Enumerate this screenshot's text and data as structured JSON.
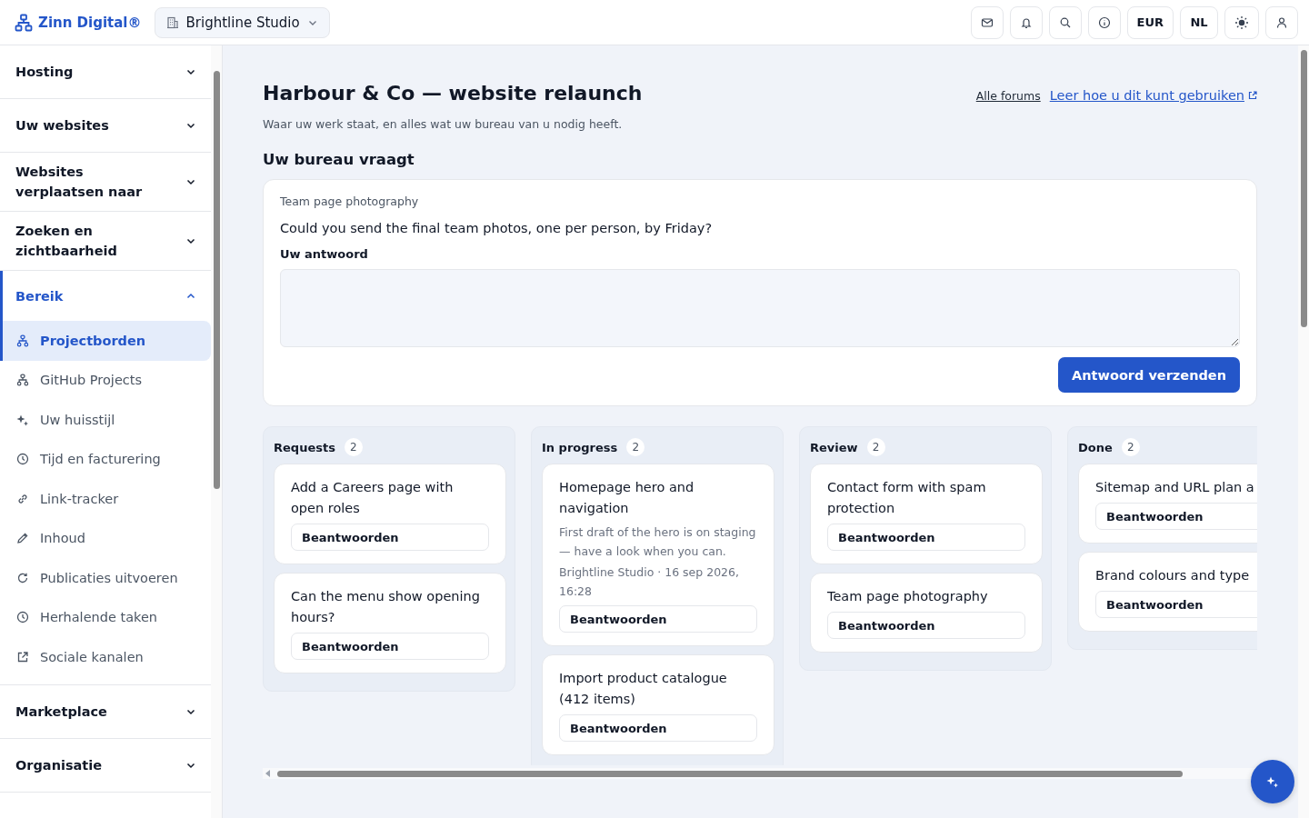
{
  "brand": {
    "name": "Zinn Digital®"
  },
  "workspace": {
    "label": "Brightline Studio"
  },
  "toolbar": {
    "currency": "EUR",
    "language": "NL"
  },
  "sidebar": {
    "groups": [
      {
        "label": "Hosting",
        "expanded": false
      },
      {
        "label": "Uw websites",
        "expanded": false
      },
      {
        "label": "Websites verplaatsen naar",
        "expanded": false
      },
      {
        "label": "Zoeken en zichtbaarheid",
        "expanded": false
      },
      {
        "label": "Bereik",
        "expanded": true,
        "children": [
          {
            "label": "Projectborden",
            "selected": true
          },
          {
            "label": "GitHub Projects",
            "selected": false
          },
          {
            "label": "Uw huisstijl",
            "selected": false
          },
          {
            "label": "Tijd en facturering",
            "selected": false
          },
          {
            "label": "Link-tracker",
            "selected": false
          },
          {
            "label": "Inhoud",
            "selected": false
          },
          {
            "label": "Publicaties uitvoeren",
            "selected": false
          },
          {
            "label": "Herhalende taken",
            "selected": false
          },
          {
            "label": "Sociale kanalen",
            "selected": false
          }
        ]
      },
      {
        "label": "Marketplace",
        "expanded": false
      },
      {
        "label": "Organisatie",
        "expanded": false
      }
    ]
  },
  "page": {
    "title": "Harbour & Co — website relaunch",
    "subtitle": "Waar uw werk staat, en alles wat uw bureau van u nodig heeft.",
    "links": [
      "Alle forums",
      "Leer hoe u dit kunt gebruiken"
    ]
  },
  "question": {
    "heading": "Uw bureau vraagt",
    "topic": "Team page photography",
    "text": "Could you send the final team photos, one per person, by Friday?",
    "answer_label": "Uw antwoord",
    "send_button": "Antwoord verzenden"
  },
  "board": {
    "columns": [
      {
        "title": "Requests",
        "count": "2",
        "cards": [
          {
            "title": "Add a Careers page with open roles",
            "button": "Beantwoorden"
          },
          {
            "title": "Can the menu show opening hours?",
            "button": "Beantwoorden"
          }
        ]
      },
      {
        "title": "In progress",
        "count": "2",
        "cards": [
          {
            "title": "Homepage hero and navigation",
            "description": "First draft of the hero is on staging — have a look when you can.",
            "meta": "Brightline Studio · 16 sep 2026, 16:28",
            "button": "Beantwoorden"
          },
          {
            "title": "Import product catalogue (412 items)",
            "button": "Beantwoorden"
          }
        ]
      },
      {
        "title": "Review",
        "count": "2",
        "cards": [
          {
            "title": "Contact form with spam protection",
            "button": "Beantwoorden"
          },
          {
            "title": "Team page photography",
            "button": "Beantwoorden"
          }
        ]
      },
      {
        "title": "Done",
        "count": "2",
        "cards": [
          {
            "title": "Sitemap and URL plan a",
            "button": "Beantwoorden"
          },
          {
            "title": "Brand colours and type",
            "button": "Beantwoorden"
          }
        ]
      }
    ]
  }
}
